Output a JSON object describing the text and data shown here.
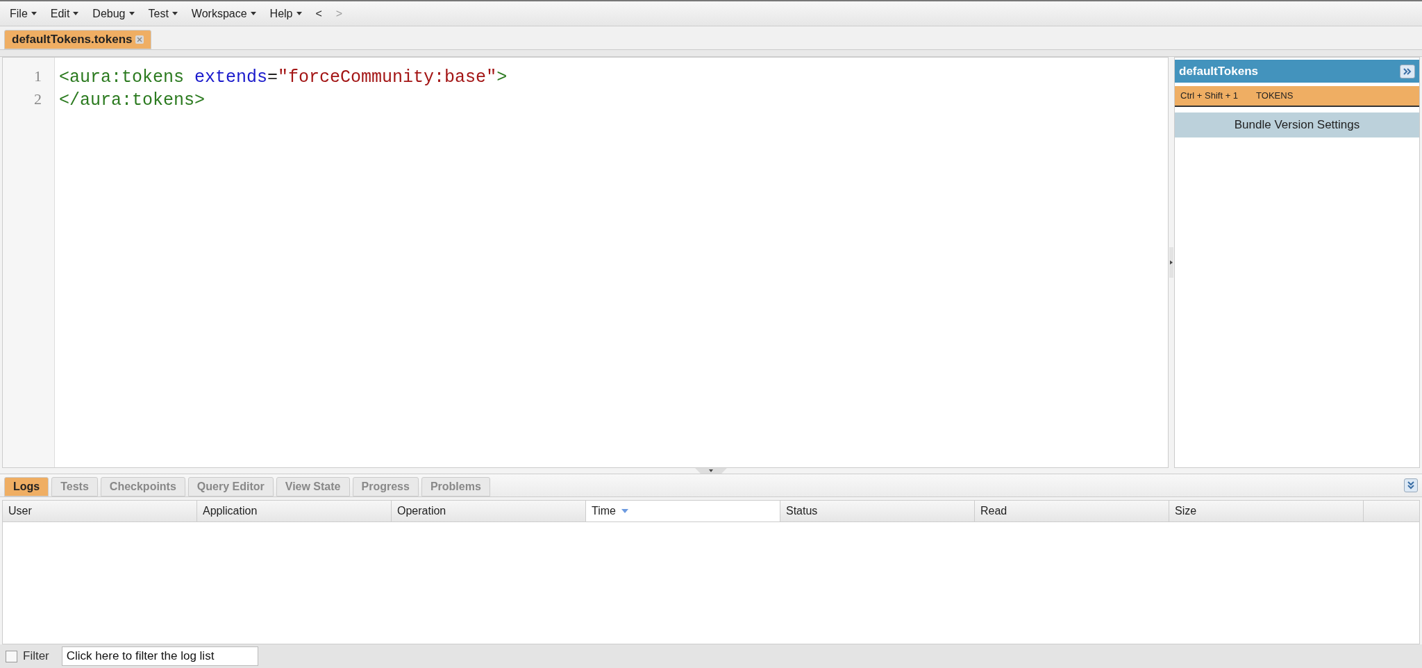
{
  "menu": [
    {
      "label": "File",
      "dropdown": true
    },
    {
      "label": "Edit",
      "dropdown": true
    },
    {
      "label": "Debug",
      "dropdown": true
    },
    {
      "label": "Test",
      "dropdown": true
    },
    {
      "label": "Workspace",
      "dropdown": true
    },
    {
      "label": "Help",
      "dropdown": true
    },
    {
      "label": "<",
      "dropdown": false,
      "disabled": false
    },
    {
      "label": ">",
      "dropdown": false,
      "disabled": true
    }
  ],
  "file_tabs": [
    {
      "label": "defaultTokens.tokens",
      "selected": true
    }
  ],
  "editor": {
    "lines": [
      {
        "number": "1",
        "tokens": [
          {
            "kind": "tag",
            "text": "<aura:tokens"
          },
          {
            "kind": "attr",
            "text": " extends"
          },
          {
            "kind": "plain",
            "text": "="
          },
          {
            "kind": "string",
            "text": "\"forceCommunity:base\""
          },
          {
            "kind": "tag",
            "text": ">"
          }
        ]
      },
      {
        "number": "2",
        "tokens": [
          {
            "kind": "tag",
            "text": "</aura:tokens>"
          }
        ]
      }
    ]
  },
  "side_panel": {
    "title": "defaultTokens",
    "shortcut": "Ctrl + Shift + 1",
    "section": "TOKENS",
    "button": "Bundle Version Settings"
  },
  "bottom_tabs": [
    {
      "label": "Logs",
      "selected": true
    },
    {
      "label": "Tests",
      "selected": false
    },
    {
      "label": "Checkpoints",
      "selected": false
    },
    {
      "label": "Query Editor",
      "selected": false
    },
    {
      "label": "View State",
      "selected": false
    },
    {
      "label": "Progress",
      "selected": false
    },
    {
      "label": "Problems",
      "selected": false
    }
  ],
  "table": {
    "columns": [
      {
        "label": "User",
        "sorted": false
      },
      {
        "label": "Application",
        "sorted": false
      },
      {
        "label": "Operation",
        "sorted": false
      },
      {
        "label": "Time",
        "sorted": true
      },
      {
        "label": "Status",
        "sorted": false
      },
      {
        "label": "Read",
        "sorted": false
      },
      {
        "label": "Size",
        "sorted": false
      }
    ]
  },
  "filter": {
    "checked": false,
    "label": "Filter",
    "placeholder": "Click here to filter the log list"
  }
}
